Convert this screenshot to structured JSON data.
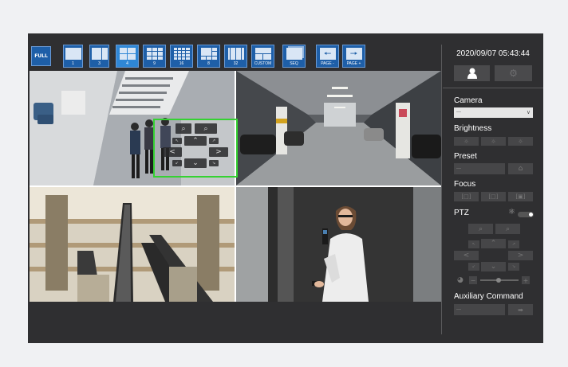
{
  "toolbar": {
    "full_label": "FULL",
    "buttons": [
      {
        "label": "1"
      },
      {
        "label": "3"
      },
      {
        "label": "4"
      },
      {
        "label": "9"
      },
      {
        "label": "16"
      },
      {
        "label": "8"
      },
      {
        "label": "32"
      },
      {
        "label": "CUSTOM"
      }
    ],
    "seq_label": "SEQ",
    "page_prev_label": "PAGE -",
    "page_next_label": "PAGE +"
  },
  "clock": "2020/09/07 05:43:44",
  "panel": {
    "camera_title": "Camera",
    "camera_value": "---",
    "brightness_title": "Brightness",
    "preset_title": "Preset",
    "preset_value": "---",
    "focus_title": "Focus",
    "ptz_title": "PTZ",
    "aux_title": "Auxiliary Command",
    "aux_value": "---"
  },
  "colors": {
    "accent": "#1e5fa8",
    "overlay_border": "#35d232",
    "app_bg": "#2f2f31"
  }
}
